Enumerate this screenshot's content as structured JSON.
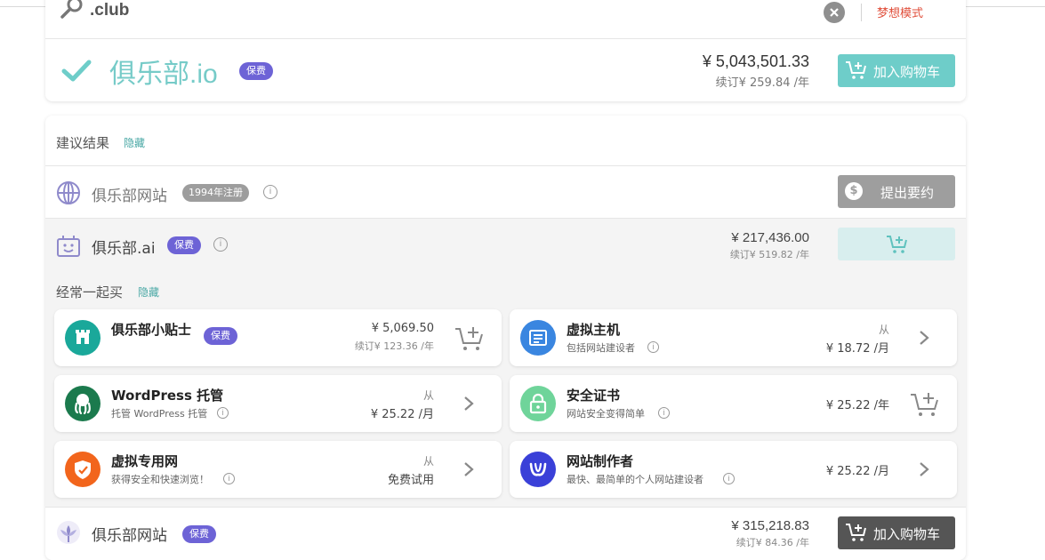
{
  "search": {
    "value": ".club",
    "dream_mode_label": "梦想模式"
  },
  "main_result": {
    "domain": "俱乐部.io",
    "badge": "保费",
    "price": "¥ 5,043,501.33",
    "renewal": "续订¥ 259.84 /年",
    "cart_label": "加入购物车"
  },
  "suggestions": {
    "title": "建议结果",
    "hide_label": "隐藏",
    "rows": [
      {
        "domain": "俱乐部网站",
        "registered_badge": "1994年注册",
        "action_label": "提出要约"
      },
      {
        "domain": "俱乐部.ai",
        "badge": "保费",
        "price": "¥ 217,436.00",
        "renewal": "续订¥ 519.82 /年"
      },
      {
        "domain": "俱乐部网站",
        "badge": "保费",
        "price": "¥ 315,218.83",
        "renewal": "续订¥ 84.36 /年",
        "cart_label": "加入购物车"
      }
    ]
  },
  "often_bought": {
    "title": "经常一起买",
    "hide_label": "隐藏",
    "tiles": [
      {
        "name": "俱乐部小贴士",
        "badge": "保费",
        "price": "¥ 5,069.50",
        "renewal": "续订¥ 123.36 /年",
        "icon": "building-icon",
        "color": "#1aa89a"
      },
      {
        "name": "虚拟主机",
        "sub": "包括网站建设者",
        "from": "从",
        "price": "¥ 18.72 /月",
        "icon": "server-icon",
        "color": "#3a86e0"
      },
      {
        "name": "WordPress 托管",
        "sub": "托管 WordPress 托管",
        "from": "从",
        "price": "¥ 25.22 /月",
        "icon": "octopus-icon",
        "color": "#1b7a4d"
      },
      {
        "name": "安全证书",
        "sub": "网站安全变得简单",
        "price": "¥ 25.22 /年",
        "icon": "lock-icon",
        "color": "#6fd49a"
      },
      {
        "name": "虚拟专用网",
        "sub": "获得安全和快速浏览！",
        "from": "从",
        "price": "免费试用",
        "icon": "shield-icon",
        "color": "#f2651c"
      },
      {
        "name": "网站制作者",
        "sub": "最快、最简单的个人网站建设者",
        "price": "¥ 25.22 /月",
        "icon": "builder-icon",
        "color": "#3a40d8"
      }
    ]
  }
}
